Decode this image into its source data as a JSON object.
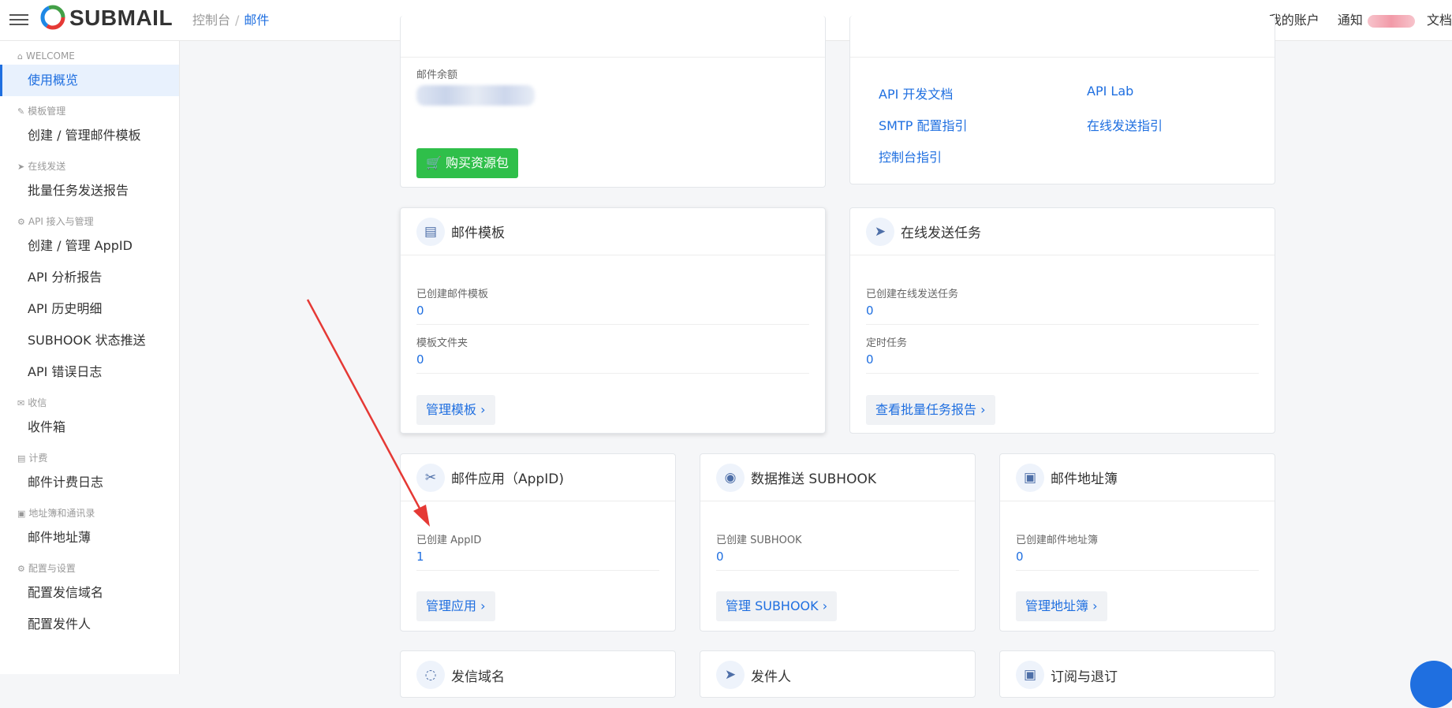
{
  "header": {
    "logo_text": "SUBMAIL",
    "breadcrumb": [
      "控制台",
      "/",
      "邮件"
    ],
    "right_items": [
      "我的账户",
      "通知",
      "文档"
    ]
  },
  "sidebar": {
    "sections": [
      {
        "title": "WELCOME",
        "icon": "home-icon",
        "items": [
          "使用概览"
        ]
      },
      {
        "title": "模板管理",
        "icon": "pencil-icon",
        "items": [
          "创建 / 管理邮件模板"
        ]
      },
      {
        "title": "在线发送",
        "icon": "send-icon",
        "items": [
          "批量任务发送报告"
        ]
      },
      {
        "title": "API 接入与管理",
        "icon": "api-icon",
        "items": [
          "创建 / 管理 AppID",
          "API 分析报告",
          "API 历史明细",
          "SUBHOOK 状态推送",
          "API 错误日志"
        ]
      },
      {
        "title": "收信",
        "icon": "inbox-icon",
        "items": [
          "收件箱"
        ]
      },
      {
        "title": "计费",
        "icon": "billing-icon",
        "items": [
          "邮件计费日志"
        ]
      },
      {
        "title": "地址簿和通讯录",
        "icon": "addressbook-icon",
        "items": [
          "邮件地址薄"
        ]
      },
      {
        "title": "配置与设置",
        "icon": "gear-icon",
        "items": [
          "配置发信域名",
          "配置发件人"
        ]
      }
    ]
  },
  "balance_card": {
    "label": "邮件余额",
    "buy_button": "购买资源包"
  },
  "docs_card": {
    "links": [
      "API 开发文档",
      "API Lab",
      "SMTP 配置指引",
      "在线发送指引",
      "控制台指引"
    ]
  },
  "template_card": {
    "title": "邮件模板",
    "fields": [
      {
        "label": "已创建邮件模板",
        "value": "0"
      },
      {
        "label": "模板文件夹",
        "value": "0"
      }
    ],
    "button": "管理模板 ›"
  },
  "online_task_card": {
    "title": "在线发送任务",
    "fields": [
      {
        "label": "已创建在线发送任务",
        "value": "0"
      },
      {
        "label": "定时任务",
        "value": "0"
      }
    ],
    "button": "查看批量任务报告 ›"
  },
  "appid_card": {
    "title": "邮件应用（AppID)",
    "field": {
      "label": "已创建 AppID",
      "value": "1"
    },
    "button": "管理应用 ›"
  },
  "subhook_card": {
    "title": "数据推送 SUBHOOK",
    "field": {
      "label": "已创建 SUBHOOK",
      "value": "0"
    },
    "button": "管理 SUBHOOK ›"
  },
  "addressbook_card": {
    "title": "邮件地址簿",
    "field": {
      "label": "已创建邮件地址簿",
      "value": "0"
    },
    "button": "管理地址簿 ›"
  },
  "bottom_cards": [
    "发信域名",
    "发件人",
    "订阅与退订"
  ],
  "colors": {
    "accent": "#1f6fe0",
    "buy": "#2fbf4a",
    "arrow": "#e53935"
  }
}
